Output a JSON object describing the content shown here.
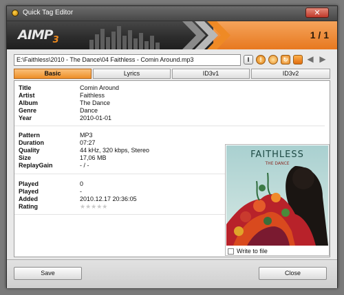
{
  "window": {
    "title": "Quick Tag Editor",
    "close_label": "✕"
  },
  "banner": {
    "logo": "AIMP",
    "logo_version": "3",
    "counter": "1 / 1"
  },
  "path": {
    "value": "E:\\Faithless\\2010 - The Dance\\04 Faithless - Comin Around.mp3"
  },
  "toolbar": {
    "icons": [
      "text-cursor-icon",
      "info-icon",
      "globe-icon",
      "refresh-icon",
      "save-tag-icon",
      "arrow-left-icon",
      "arrow-right-icon"
    ],
    "text_btn": "I",
    "prev": "◀",
    "next": "▶"
  },
  "tabs": [
    {
      "label": "Basic",
      "active": true
    },
    {
      "label": "Lyrics",
      "active": false
    },
    {
      "label": "ID3v1",
      "active": false
    },
    {
      "label": "ID3v2",
      "active": false
    }
  ],
  "basic": [
    {
      "label": "Title",
      "value": "Comin Around"
    },
    {
      "label": "Artist",
      "value": "Faithless"
    },
    {
      "label": "Album",
      "value": "The Dance"
    },
    {
      "label": "Genre",
      "value": "Dance"
    },
    {
      "label": "Year",
      "value": "2010-01-01"
    }
  ],
  "technical": [
    {
      "label": "Pattern",
      "value": "MP3"
    },
    {
      "label": "Duration",
      "value": "07:27"
    },
    {
      "label": "Quality",
      "value": "44 kHz, 320 kbps, Stereo"
    },
    {
      "label": "Size",
      "value": "17,06 MB"
    },
    {
      "label": "ReplayGain",
      "value": "- / -"
    }
  ],
  "stats": [
    {
      "label": "Played",
      "value": "0"
    },
    {
      "label": "Played",
      "value": "-"
    },
    {
      "label": "Added",
      "value": "2010.12.17 20:36:05"
    },
    {
      "label": "Rating",
      "value": "★★★★★",
      "rating": 0,
      "max": 5
    }
  ],
  "album_art": {
    "artist_text": "FAITHLESS",
    "album_text": "THE DANCE",
    "write_to_file_label": "Write to file",
    "write_to_file_checked": false
  },
  "footer": {
    "save_label": "Save",
    "close_label": "Close"
  },
  "colors": {
    "accent": "#ee8f28",
    "banner_dark": "#2d2d2d",
    "title_close": "#c0392b"
  }
}
